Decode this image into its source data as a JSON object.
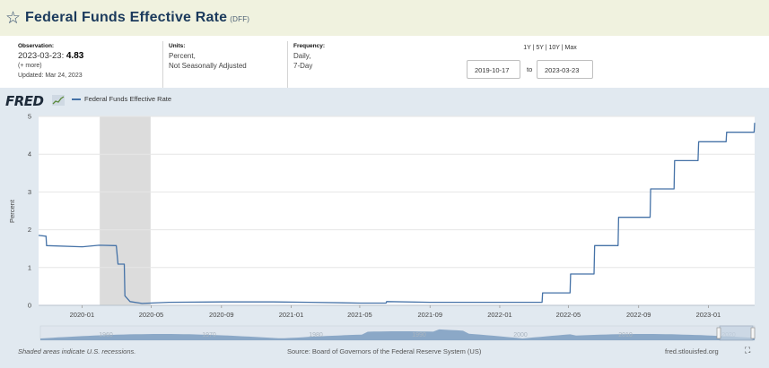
{
  "header": {
    "title": "Federal Funds Effective Rate",
    "series_id": "(DFF)"
  },
  "meta": {
    "observation_label": "Observation:",
    "observation_date": "2023-03-23:",
    "observation_value": "4.83",
    "more": "(+ more)",
    "updated": "Updated: Mar 24, 2023",
    "units_label": "Units:",
    "units_line1": "Percent,",
    "units_line2": "Not Seasonally Adjusted",
    "frequency_label": "Frequency:",
    "frequency_line1": "Daily,",
    "frequency_line2": "7-Day"
  },
  "range": {
    "periods": "1Y | 5Y | 10Y | Max",
    "start": "2019-10-17",
    "to": "to",
    "end": "2023-03-23"
  },
  "graph": {
    "logo": "FRED",
    "legend": "Federal Funds Effective Rate"
  },
  "footer": {
    "recession_note": "Shaded areas indicate U.S. recessions.",
    "source": "Source: Board of Governors of the Federal Reserve System (US)",
    "site": "fred.stlouisfed.org",
    "expand_icon": "⛶"
  },
  "colors": {
    "line": "#4572a7",
    "recession": "#dcdcdc",
    "navigator_fill": "#7d9cc0",
    "title_bar": "#f0f2df",
    "graph_bg": "#e1e9f0"
  },
  "chart_data": {
    "type": "line",
    "title": "",
    "xlabel": "",
    "ylabel": "Percent",
    "ylim": [
      0,
      5
    ],
    "xlim": [
      "2019-10-17",
      "2023-03-23"
    ],
    "yticks": [
      "0",
      "1",
      "2",
      "3",
      "4",
      "5"
    ],
    "xticks": [
      {
        "date": "2020-01-01",
        "label": "2020-01"
      },
      {
        "date": "2020-05-01",
        "label": "2020-05"
      },
      {
        "date": "2020-09-01",
        "label": "2020-09"
      },
      {
        "date": "2021-01-01",
        "label": "2021-01"
      },
      {
        "date": "2021-05-01",
        "label": "2021-05"
      },
      {
        "date": "2021-09-01",
        "label": "2021-09"
      },
      {
        "date": "2022-01-01",
        "label": "2022-01"
      },
      {
        "date": "2022-05-01",
        "label": "2022-05"
      },
      {
        "date": "2022-09-01",
        "label": "2022-09"
      },
      {
        "date": "2023-01-01",
        "label": "2023-01"
      }
    ],
    "grid": true,
    "recessions": [
      {
        "start": "2020-02-01",
        "end": "2020-04-30"
      }
    ],
    "series": [
      {
        "name": "Federal Funds Effective Rate",
        "points": [
          [
            "2019-10-17",
            1.85
          ],
          [
            "2019-10-30",
            1.83
          ],
          [
            "2019-10-31",
            1.58
          ],
          [
            "2019-12-31",
            1.55
          ],
          [
            "2020-01-02",
            1.55
          ],
          [
            "2020-01-31",
            1.59
          ],
          [
            "2020-02-28",
            1.58
          ],
          [
            "2020-03-01",
            1.58
          ],
          [
            "2020-03-04",
            1.09
          ],
          [
            "2020-03-15",
            1.09
          ],
          [
            "2020-03-16",
            0.25
          ],
          [
            "2020-03-25",
            0.1
          ],
          [
            "2020-04-15",
            0.05
          ],
          [
            "2020-06-01",
            0.08
          ],
          [
            "2020-09-01",
            0.09
          ],
          [
            "2020-12-01",
            0.09
          ],
          [
            "2021-02-01",
            0.08
          ],
          [
            "2021-05-01",
            0.06
          ],
          [
            "2021-06-16",
            0.06
          ],
          [
            "2021-06-17",
            0.1
          ],
          [
            "2021-09-01",
            0.08
          ],
          [
            "2021-12-01",
            0.08
          ],
          [
            "2022-03-16",
            0.08
          ],
          [
            "2022-03-17",
            0.33
          ],
          [
            "2022-05-04",
            0.33
          ],
          [
            "2022-05-05",
            0.83
          ],
          [
            "2022-06-15",
            0.83
          ],
          [
            "2022-06-16",
            1.58
          ],
          [
            "2022-07-27",
            1.58
          ],
          [
            "2022-07-28",
            2.33
          ],
          [
            "2022-09-21",
            2.33
          ],
          [
            "2022-09-22",
            3.08
          ],
          [
            "2022-11-02",
            3.08
          ],
          [
            "2022-11-03",
            3.83
          ],
          [
            "2022-12-14",
            3.83
          ],
          [
            "2022-12-15",
            4.33
          ],
          [
            "2023-02-01",
            4.33
          ],
          [
            "2023-02-02",
            4.58
          ],
          [
            "2023-03-22",
            4.58
          ],
          [
            "2023-03-23",
            4.83
          ]
        ]
      }
    ]
  },
  "navigator": {
    "labels": [
      "1960",
      "1970",
      "1980",
      "1990",
      "2000",
      "2010",
      "2020"
    ]
  }
}
